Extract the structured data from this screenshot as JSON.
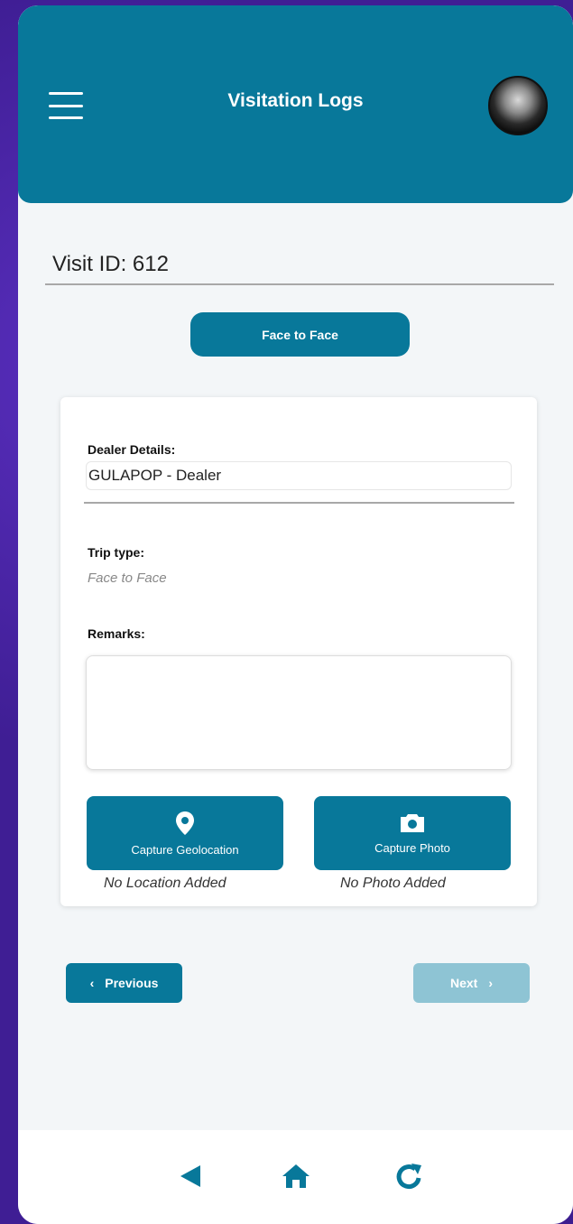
{
  "header": {
    "title": "Visitation Logs",
    "menu_icon": "hamburger-icon",
    "avatar": "user-avatar"
  },
  "visit": {
    "id_label": "Visit ID: 612",
    "type_button": "Face to Face"
  },
  "card": {
    "dealer_label": "Dealer Details:",
    "dealer_value": "GULAPOP - Dealer",
    "trip_label": "Trip type:",
    "trip_value": "Face to Face",
    "remarks_label": "Remarks:",
    "remarks_value": "",
    "geo_button": "Capture Geolocation",
    "geo_icon": "map-pin-icon",
    "photo_button": "Capture Photo",
    "photo_icon": "camera-icon",
    "geo_status": "No Location Added",
    "photo_status": "No Photo Added"
  },
  "nav": {
    "previous": "Previous",
    "next": "Next"
  },
  "bottom_bar": {
    "icons": [
      "back-triangle-icon",
      "home-icon",
      "refresh-icon"
    ]
  },
  "colors": {
    "primary": "#08789a",
    "disabled": "#8ec4d4",
    "background": "#f3f6f8"
  }
}
